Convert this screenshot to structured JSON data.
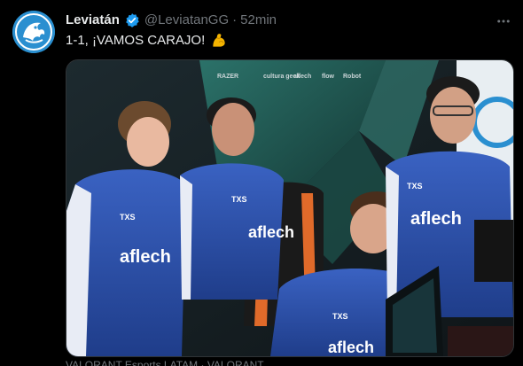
{
  "tweet": {
    "display_name": "Leviatán",
    "handle": "@LeviatanGG",
    "separator": "·",
    "time": "52min",
    "text": "1-1, ¡VAMOS CARAJO!",
    "emoji": "flexed-biceps-icon",
    "caption": "VALORANT Esports LATAM · VALORANT"
  },
  "media": {
    "sponsor_strip": [
      "RAZER",
      "cultura geek",
      "aflech",
      "flow",
      "Robot"
    ],
    "jersey_sponsor": "aflech",
    "jersey_badge": "TXS"
  },
  "colors": {
    "background": "#000000",
    "text_primary": "#e7e9ea",
    "text_secondary": "#71767b",
    "verified": "#1d9bf0",
    "jersey_blue": "#2a4fa8",
    "avatar_blue": "#2a8fd0"
  }
}
